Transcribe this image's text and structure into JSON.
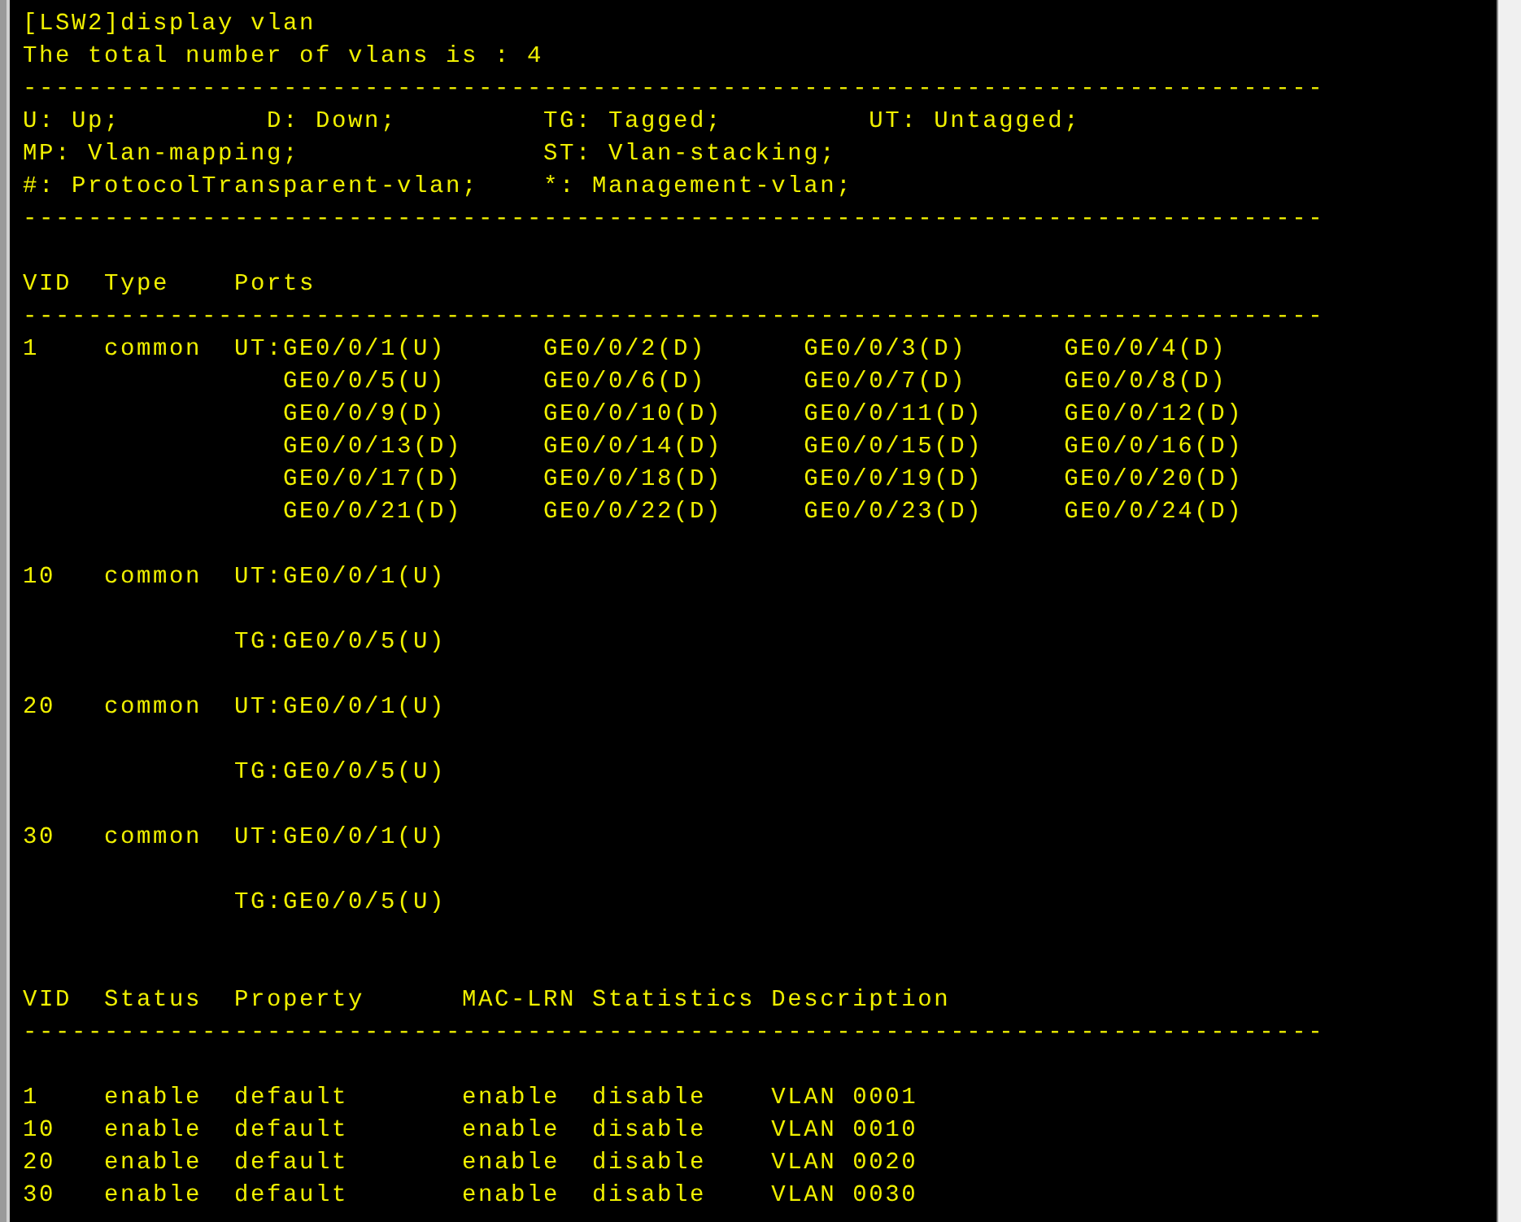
{
  "terminal": {
    "lines": [
      {
        "kind": "text",
        "text": "[LSW2]display vlan"
      },
      {
        "kind": "text",
        "text": "The total number of vlans is : 4"
      },
      {
        "kind": "text",
        "text": "--------------------------------------------------------------------------------"
      },
      {
        "kind": "text",
        "text": "U: Up;         D: Down;         TG: Tagged;         UT: Untagged;"
      },
      {
        "kind": "text",
        "text": "MP: Vlan-mapping;               ST: Vlan-stacking;"
      },
      {
        "kind": "text",
        "text": "#: ProtocolTransparent-vlan;    *: Management-vlan;"
      },
      {
        "kind": "text",
        "text": "--------------------------------------------------------------------------------"
      },
      {
        "kind": "blank"
      },
      {
        "kind": "text",
        "text": "VID  Type    Ports"
      },
      {
        "kind": "text",
        "text": "--------------------------------------------------------------------------------"
      },
      {
        "kind": "text",
        "text": "1    common  UT:GE0/0/1(U)      GE0/0/2(D)      GE0/0/3(D)      GE0/0/4(D)"
      },
      {
        "kind": "text",
        "text": "                GE0/0/5(U)      GE0/0/6(D)      GE0/0/7(D)      GE0/0/8(D)"
      },
      {
        "kind": "text",
        "text": "                GE0/0/9(D)      GE0/0/10(D)     GE0/0/11(D)     GE0/0/12(D)"
      },
      {
        "kind": "text",
        "text": "                GE0/0/13(D)     GE0/0/14(D)     GE0/0/15(D)     GE0/0/16(D)"
      },
      {
        "kind": "text",
        "text": "                GE0/0/17(D)     GE0/0/18(D)     GE0/0/19(D)     GE0/0/20(D)"
      },
      {
        "kind": "text",
        "text": "                GE0/0/21(D)     GE0/0/22(D)     GE0/0/23(D)     GE0/0/24(D)"
      },
      {
        "kind": "blank"
      },
      {
        "kind": "text",
        "text": "10   common  UT:GE0/0/1(U)"
      },
      {
        "kind": "blank"
      },
      {
        "kind": "text",
        "text": "             TG:GE0/0/5(U)"
      },
      {
        "kind": "blank"
      },
      {
        "kind": "text",
        "text": "20   common  UT:GE0/0/1(U)"
      },
      {
        "kind": "blank"
      },
      {
        "kind": "text",
        "text": "             TG:GE0/0/5(U)"
      },
      {
        "kind": "blank"
      },
      {
        "kind": "text",
        "text": "30   common  UT:GE0/0/1(U)"
      },
      {
        "kind": "blank"
      },
      {
        "kind": "text",
        "text": "             TG:GE0/0/5(U)"
      },
      {
        "kind": "blank"
      },
      {
        "kind": "blank"
      },
      {
        "kind": "text",
        "text": "VID  Status  Property      MAC-LRN Statistics Description"
      },
      {
        "kind": "text",
        "text": "--------------------------------------------------------------------------------"
      },
      {
        "kind": "blank"
      },
      {
        "kind": "text",
        "text": "1    enable  default       enable  disable    VLAN 0001"
      },
      {
        "kind": "text",
        "text": "10   enable  default       enable  disable    VLAN 0010"
      },
      {
        "kind": "text",
        "text": "20   enable  default       enable  disable    VLAN 0020"
      },
      {
        "kind": "text",
        "text": "30   enable  default       enable  disable    VLAN 0030"
      }
    ]
  }
}
